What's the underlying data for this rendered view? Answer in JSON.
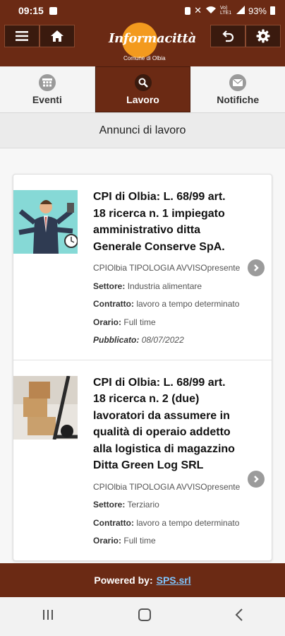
{
  "status_bar": {
    "time": "09:15",
    "network_label": "Vo) LTE1",
    "battery": "93%"
  },
  "header": {
    "logo_text": "Informacittà",
    "logo_subtitle": "Comune di Olbia"
  },
  "tabs": [
    {
      "label": "Eventi",
      "icon": "calendar-icon",
      "active": false
    },
    {
      "label": "Lavoro",
      "icon": "search-icon",
      "active": true
    },
    {
      "label": "Notifiche",
      "icon": "mail-icon",
      "active": false
    }
  ],
  "page_title": "Annunci di lavoro",
  "listings": [
    {
      "title": "CPI di Olbia: L. 68/99 art. 18 ricerca n. 1 impiegato amministrativo ditta Generale Conserve SpA.",
      "summary": "CPIOlbia TIPOLOGIA AVVISOpresente",
      "settore_label": "Settore:",
      "settore": "Industria alimentare",
      "contratto_label": "Contratto:",
      "contratto": "lavoro a tempo determinato",
      "orario_label": "Orario:",
      "orario": "Full time",
      "pubblicato_label": "Pubblicato:",
      "pubblicato": "08/07/2022",
      "image": "businessman-multitasking-illustration"
    },
    {
      "title": "CPI di Olbia: L. 68/99 art. 18 ricerca n. 2 (due) lavoratori da assumere in qualità di operaio addetto alla logistica di magazzino Ditta Green Log SRL",
      "summary": "CPIOlbia   TIPOLOGIA AVVISOpresente",
      "settore_label": "Settore:",
      "settore": "Terziario",
      "contratto_label": "Contratto:",
      "contratto": "lavoro a tempo determinato",
      "orario_label": "Orario:",
      "orario": "Full time",
      "image": "hand-truck-boxes-photo"
    }
  ],
  "footer": {
    "prefix": "Powered by:",
    "link": "SPS.srl"
  },
  "colors": {
    "brand": "#6b2a14",
    "accent": "#f39a1e",
    "link": "#7fc6ff"
  }
}
